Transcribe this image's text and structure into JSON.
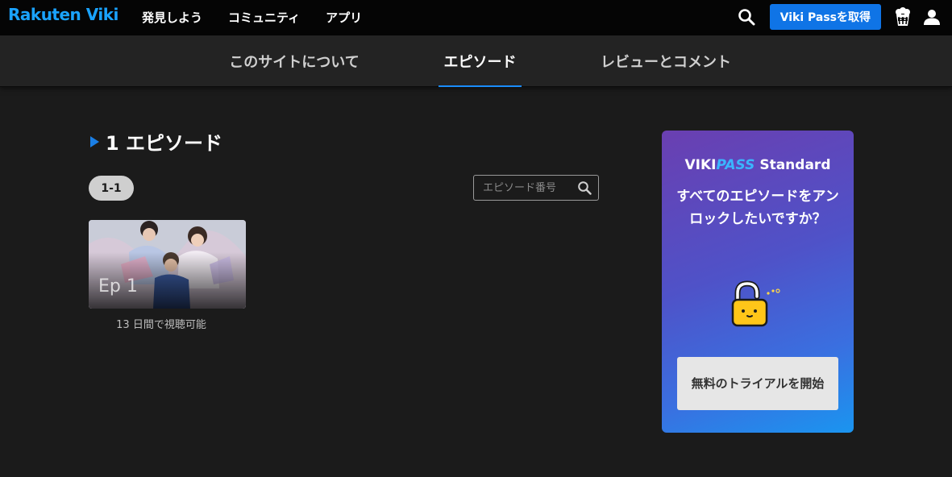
{
  "header": {
    "logo": "Rakuten Viki",
    "nav": [
      "発見しよう",
      "コミュニティ",
      "アプリ"
    ],
    "pass_button": "Viki Passを取得",
    "icons": [
      "search-icon",
      "popcorn-icon",
      "user-icon"
    ]
  },
  "tabs": [
    {
      "label": "このサイトについて",
      "active": false
    },
    {
      "label": "エピソード",
      "active": true
    },
    {
      "label": "レビューとコメント",
      "active": false
    }
  ],
  "episodes": {
    "title": "1 エピソード",
    "range": "1-1",
    "search_placeholder": "エピソード番号",
    "items": [
      {
        "label": "Ep 1",
        "availability": "13 日間で視聴可能"
      }
    ]
  },
  "promo": {
    "brand_viki": "VIKI",
    "brand_pass": "PASS",
    "brand_tier": "Standard",
    "heading": "すべてのエピソードをアンロックしたいですか？",
    "cta": "無料のトライアルを開始"
  },
  "colors": {
    "accent": "#0f74e6",
    "tab_underline": "#1a8cff",
    "logo": "#1aa3ff",
    "background": "#1b1b1b"
  }
}
